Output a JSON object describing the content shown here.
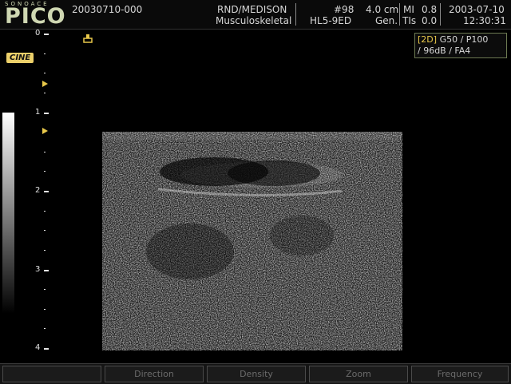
{
  "header": {
    "brand_small": "SONOACE",
    "brand": "PICO",
    "patient_id": "20030710-000",
    "institution": "RND/MEDISON",
    "application": "Musculoskeletal",
    "image_number": "#98",
    "probe": "HL5-9ED",
    "depth": "4.0 cm",
    "frequency_mode": "Gen.",
    "mi_label": "MI",
    "mi_value": "0.8",
    "tis_label": "TIs",
    "tis_value": "0.0",
    "date": "2003-07-10",
    "time": "12:30:31"
  },
  "cine_label": "CINE",
  "settings": {
    "mode": "[2D]",
    "line1": "G50 / P100",
    "line2": "/ 96dB / FA4"
  },
  "depth_scale": {
    "labels": [
      "0",
      "1",
      "2",
      "3",
      "4"
    ]
  },
  "softkeys": [
    {
      "label": ""
    },
    {
      "label": "Direction"
    },
    {
      "label": "Density"
    },
    {
      "label": "Zoom"
    },
    {
      "label": "Frequency"
    }
  ],
  "colors": {
    "brand": "#cfd7b2",
    "accent_yellow": "#e8c84a",
    "settings_border": "#6d7a52"
  },
  "icons": [
    "probe-orientation-icon",
    "focus-marker-icon"
  ]
}
